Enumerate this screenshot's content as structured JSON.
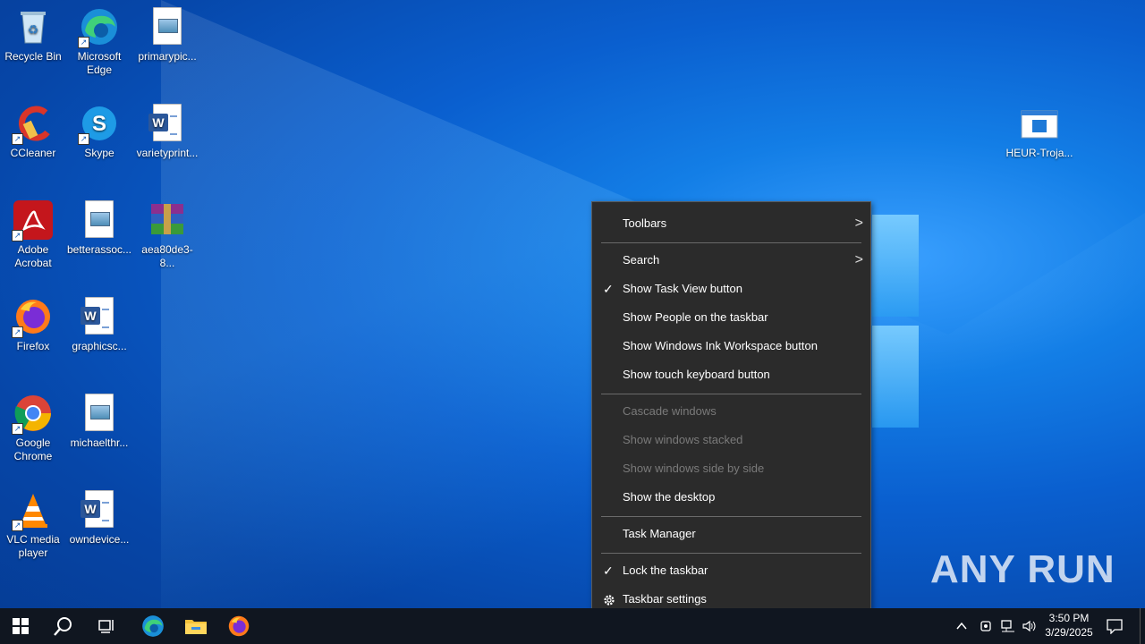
{
  "desktop": {
    "icons": [
      {
        "label": "Recycle Bin"
      },
      {
        "label": "Microsoft Edge"
      },
      {
        "label": "primarypic..."
      },
      {
        "label": "CCleaner"
      },
      {
        "label": "Skype"
      },
      {
        "label": "varietyprint..."
      },
      {
        "label": "Adobe Acrobat"
      },
      {
        "label": "betterassoc..."
      },
      {
        "label": "aea80de3-8..."
      },
      {
        "label": "Firefox"
      },
      {
        "label": "graphicsc..."
      },
      {
        "label": "Google Chrome"
      },
      {
        "label": "michaelthr..."
      },
      {
        "label": "VLC media player"
      },
      {
        "label": "owndevice..."
      },
      {
        "label": "HEUR-Troja..."
      }
    ],
    "watermark": "ANY RUN"
  },
  "context_menu": {
    "items": [
      {
        "label": "Toolbars",
        "submenu": true
      },
      {
        "label": "Search",
        "submenu": true
      },
      {
        "label": "Show Task View button",
        "checked": true
      },
      {
        "label": "Show People on the taskbar"
      },
      {
        "label": "Show Windows Ink Workspace button"
      },
      {
        "label": "Show touch keyboard button"
      },
      {
        "label": "Cascade windows",
        "disabled": true
      },
      {
        "label": "Show windows stacked",
        "disabled": true
      },
      {
        "label": "Show windows side by side",
        "disabled": true
      },
      {
        "label": "Show the desktop"
      },
      {
        "label": "Task Manager"
      },
      {
        "label": "Lock the taskbar",
        "checked": true
      },
      {
        "label": "Taskbar settings"
      }
    ],
    "check_glyph": "✓",
    "arrow_glyph": ">"
  },
  "taskbar": {
    "pinned": [
      "start-icon",
      "search-icon",
      "task-view-icon",
      "edge-icon",
      "file-explorer-icon",
      "firefox-icon"
    ],
    "clock": {
      "time": "3:50 PM",
      "date": "3/29/2025"
    }
  },
  "colors": {
    "menu_bg": "#2b2b2b",
    "taskbar_bg": "#101620",
    "desktop_accent": "#0a5fcf"
  }
}
